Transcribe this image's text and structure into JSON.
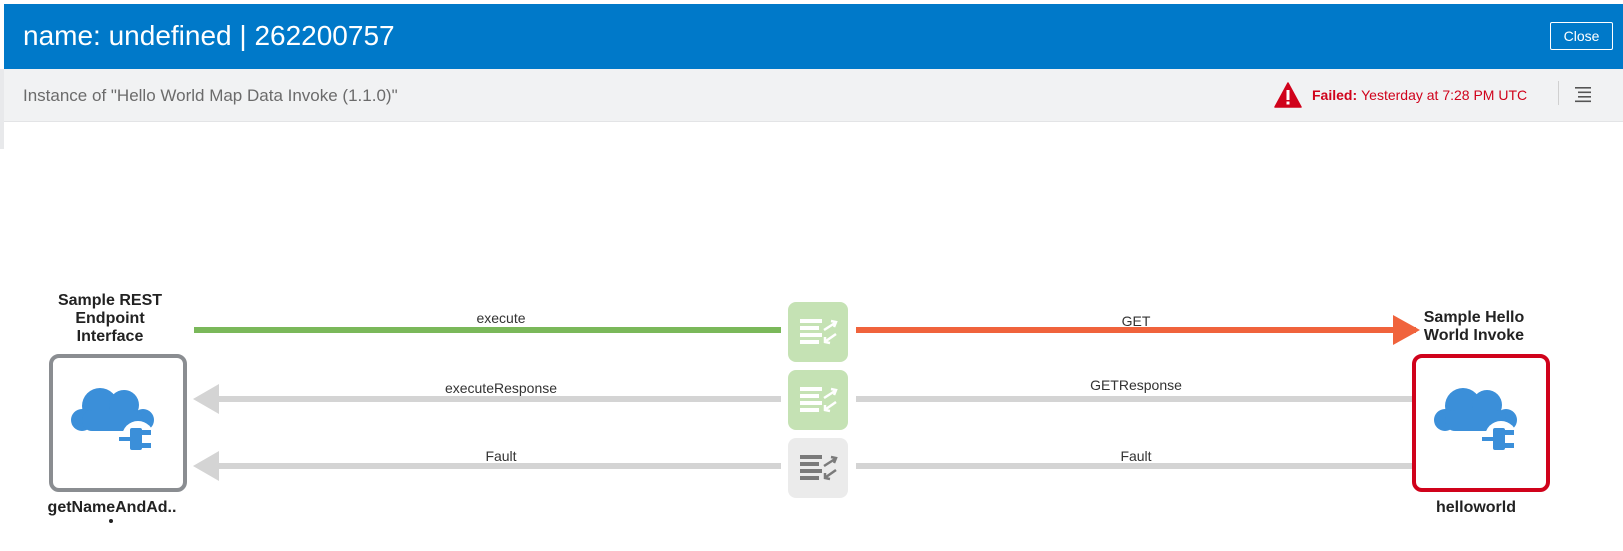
{
  "dialog": {
    "title": "name: undefined | 262200757",
    "close_label": "Close"
  },
  "subheader": {
    "instance_text": "Instance of \"Hello World Map Data Invoke (1.1.0)\"",
    "status_label": "Failed:",
    "status_time": "Yesterday at 7:28 PM UTC",
    "status_icon": "warning-triangle-icon",
    "menu_icon": "list-menu-icon"
  },
  "colors": {
    "header_blue": "#0079c9",
    "success_green": "#7ab85a",
    "active_orange": "#f0633c",
    "idle_gray": "#d4d4d4",
    "failed_red": "#d0021b",
    "trigger_border": "#8a8d91",
    "cloud_blue": "#3b8fd9",
    "mapper_green": "#c5e2b4",
    "mapper_gray": "#ebebeb"
  },
  "flow": {
    "trigger": {
      "title": "Sample REST Endpoint Interface",
      "name": "getNameAndAd..",
      "icon": "cloud-plug-icon"
    },
    "invoke": {
      "title": "Sample Hello World Invoke",
      "name": "helloworld",
      "icon": "cloud-plug-icon",
      "status": "failed"
    },
    "connections": {
      "execute": "execute",
      "get": "GET",
      "execute_response": "executeResponse",
      "get_response": "GETResponse",
      "fault_left": "Fault",
      "fault_right": "Fault"
    },
    "mappers": [
      {
        "icon": "map-data-icon",
        "state": "completed"
      },
      {
        "icon": "map-data-icon",
        "state": "completed"
      },
      {
        "icon": "map-data-icon",
        "state": "not-run"
      }
    ]
  }
}
